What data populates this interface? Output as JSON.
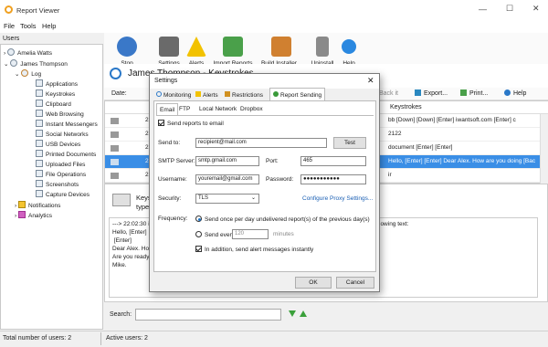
{
  "window": {
    "title": "Report Viewer",
    "min": "—",
    "max": "☐",
    "close": "✕"
  },
  "menu": [
    "File",
    "Tools",
    "Help"
  ],
  "users_label": "Users",
  "tree": {
    "user1": "Amelia Watts",
    "user2": "James Thompson",
    "log": "Log",
    "log_items": [
      "Applications",
      "Keystrokes",
      "Clipboard",
      "Web Browsing",
      "Instant Messengers",
      "Social Networks",
      "USB Devices",
      "Printed Documents",
      "Uploaded Files",
      "File Operations",
      "Screenshots",
      "Capture Devices"
    ],
    "notifications": "Notifications",
    "analytics": "Analytics"
  },
  "toolbar": [
    "Stop Monitoring",
    "Settings",
    "Alerts",
    "Import Reports",
    "Build Installer...",
    "Uninstall",
    "Help"
  ],
  "viewer": {
    "user_header": "James Thompson - Keystrokes",
    "date_label": "Date:",
    "back_label": "Back it",
    "export_label": "Export...",
    "print_label": "Print...",
    "help_label": "Help",
    "col_keystrokes": "Keystrokes",
    "rows": [
      {
        "num": "21",
        "keys": "bb [Down] [Down] [Enter] iwantsoft.com [Enter] c"
      },
      {
        "num": "22",
        "keys": "2122"
      },
      {
        "num": "22",
        "keys": "document [Enter] [Enter]"
      },
      {
        "num": "22",
        "keys": "Hello, [Enter] [Enter] Dear Alex. How are you doing [Bac"
      },
      {
        "num": "22",
        "keys": "ir"
      }
    ],
    "detail_title": "Keys",
    "detail_sub": "type",
    "detail_right": "lowing text:",
    "detail_lines": [
      "---> 22:02:30 ir",
      "Hello, [Enter]",
      " [Enter]",
      "Dear Alex. How",
      "Are you ready f",
      "Mike."
    ],
    "search_label": "Search:"
  },
  "status": {
    "total": "Total number of users: 2",
    "active": "Active users: 2"
  },
  "dialog": {
    "title": "Settings",
    "tabs": [
      "Monitoring",
      "Alerts",
      "Restrictions",
      "Report Sending"
    ],
    "subtabs": [
      "Email",
      "FTP",
      "Local Network",
      "Dropbox"
    ],
    "send_reports": "Send reports to email",
    "send_to_label": "Send to:",
    "send_to_value": "recipient@mail.com",
    "test_button": "Test",
    "smtp_label": "SMTP Server:",
    "smtp_value": "smtp.gmail.com",
    "port_label": "Port:",
    "port_value": "465",
    "username_label": "Username:",
    "username_value": "youremail@gmail.com",
    "password_label": "Password:",
    "password_value": "●●●●●●●●●●●",
    "security_label": "Security:",
    "security_value": "TLS",
    "proxy_link": "Configure Proxy Settings...",
    "frequency_label": "Frequency:",
    "freq_option1": "Send once per day undelivered report(s) of the previous day(s)",
    "freq_option2_pre": "Send every",
    "freq_option2_value": "120",
    "freq_option2_unit": "minutes",
    "alert_instantly": "In addition, send alert messages instantly",
    "ok": "OK",
    "cancel": "Cancel"
  }
}
